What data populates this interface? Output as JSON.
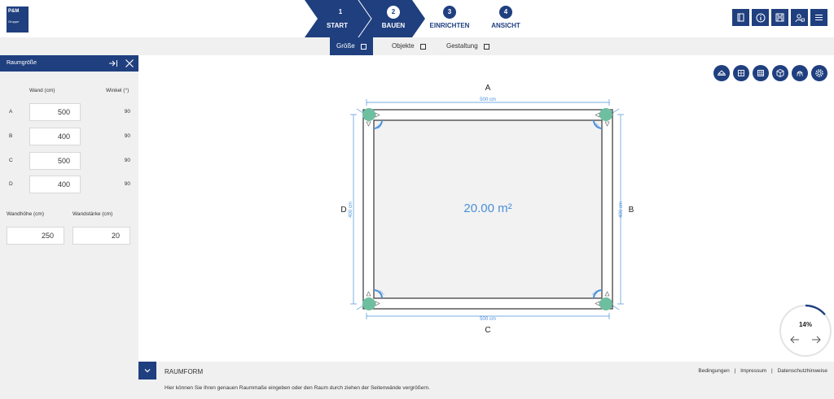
{
  "brand": {
    "name": "P&M",
    "sub": "Gruppe"
  },
  "steps": [
    {
      "num": "1",
      "label": "START"
    },
    {
      "num": "2",
      "label": "BAUEN"
    },
    {
      "num": "3",
      "label": "EINRICHTEN"
    },
    {
      "num": "4",
      "label": "ANSICHT"
    }
  ],
  "toolbar": [
    "book-icon",
    "info-icon",
    "save-icon",
    "user-lock-icon",
    "menu-icon"
  ],
  "subnav": {
    "size": "Größe",
    "objects": "Objekte",
    "design": "Gestaltung"
  },
  "panel": {
    "title": "Raumgröße",
    "col_wall": "Wand (cm)",
    "col_angle": "Winkel (°)",
    "rows": [
      {
        "label": "A",
        "wall": "500",
        "angle": "90"
      },
      {
        "label": "B",
        "wall": "400",
        "angle": "90"
      },
      {
        "label": "C",
        "wall": "500",
        "angle": "90"
      },
      {
        "label": "D",
        "wall": "400",
        "angle": "90"
      }
    ],
    "height_label": "Wandhöhe (cm)",
    "thickness_label": "Wandstärke (cm)",
    "height_value": "250",
    "thickness_value": "20"
  },
  "room": {
    "area": "20.00 m²",
    "side_a": "A",
    "side_b": "B",
    "side_c": "C",
    "side_d": "D",
    "dim_top": "500 cm",
    "dim_bottom": "500 cm",
    "dim_left": "400 cm",
    "dim_right": "400 cm",
    "corner_angle": "90°"
  },
  "view_tools": [
    "ceiling-icon",
    "floor-icon",
    "texture-icon",
    "3d-cube-icon",
    "light-icon",
    "settings-icon"
  ],
  "progress": {
    "percent_text": "14%",
    "value": 0.14
  },
  "bottom": {
    "title": "RAUMFORM",
    "text": "Hier können Sie Ihren genauen Raummaße eingeben oder den Raum durch ziehen der Seitenwände vergrößern."
  },
  "footer": {
    "terms": "Bedingungen",
    "imprint": "Impressum",
    "privacy": "Datenschutzhinweise",
    "sep": "|"
  },
  "colors": {
    "primary": "#1f3f7f",
    "accent": "#4a90d9",
    "corner": "#6dbfa0"
  }
}
